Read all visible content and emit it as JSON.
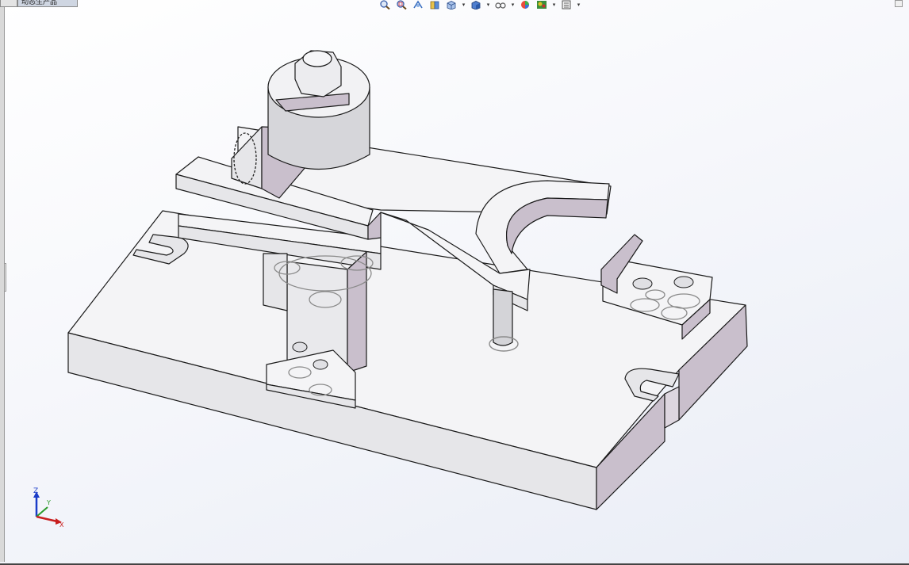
{
  "window": {
    "tabs": [
      {
        "label": "",
        "active": false
      },
      {
        "label": "动态生产品",
        "active": true
      }
    ]
  },
  "toolbar": {
    "buttons": [
      {
        "icon": "zoom-to-fit-icon"
      },
      {
        "icon": "zoom-area-icon"
      },
      {
        "icon": "previous-view-icon"
      },
      {
        "icon": "section-view-icon"
      },
      {
        "icon": "view-orientation-icon"
      },
      {
        "icon": "display-style-icon"
      },
      {
        "icon": "hide-show-items-icon"
      },
      {
        "icon": "edit-appearance-icon"
      },
      {
        "icon": "apply-scene-icon"
      },
      {
        "icon": "view-settings-icon"
      }
    ]
  },
  "triad": {
    "z_label": "Z",
    "y_label": "Y",
    "x_label": "X",
    "colors": {
      "z": "#1a3cc8",
      "y": "#2a9a2a",
      "x": "#c81e1e"
    }
  },
  "colors": {
    "face_top": "#f4f4f6",
    "face_front": "#e6e6e9",
    "face_side": "#c9bfcc",
    "edge": "#1a1a1a"
  }
}
